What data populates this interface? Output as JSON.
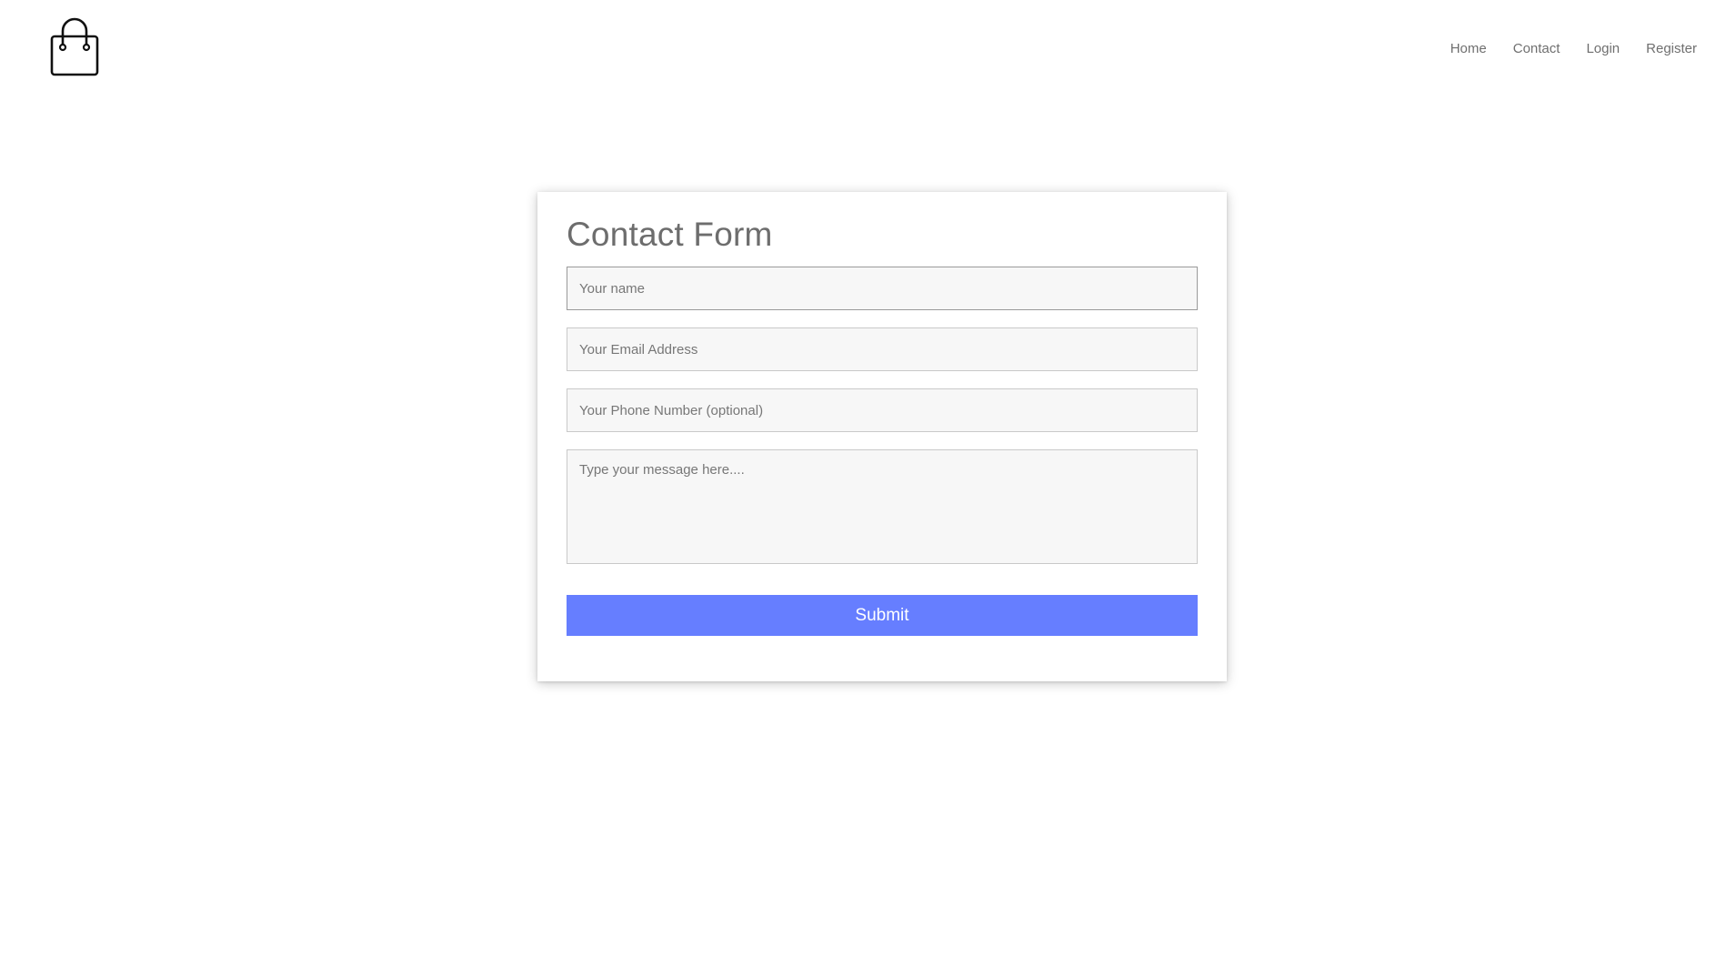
{
  "header": {
    "logo_icon": "shopping-bag-icon",
    "nav": {
      "home": "Home",
      "contact": "Contact",
      "login": "Login",
      "register": "Register"
    }
  },
  "contact_form": {
    "title": "Contact Form",
    "name_placeholder": "Your name",
    "email_placeholder": "Your Email Address",
    "phone_placeholder": "Your Phone Number (optional)",
    "message_placeholder": "Type your message here....",
    "submit_label": "Submit"
  },
  "colors": {
    "accent": "#667eff",
    "title_text": "#6d6d6d",
    "field_background": "#f7f7f7"
  }
}
